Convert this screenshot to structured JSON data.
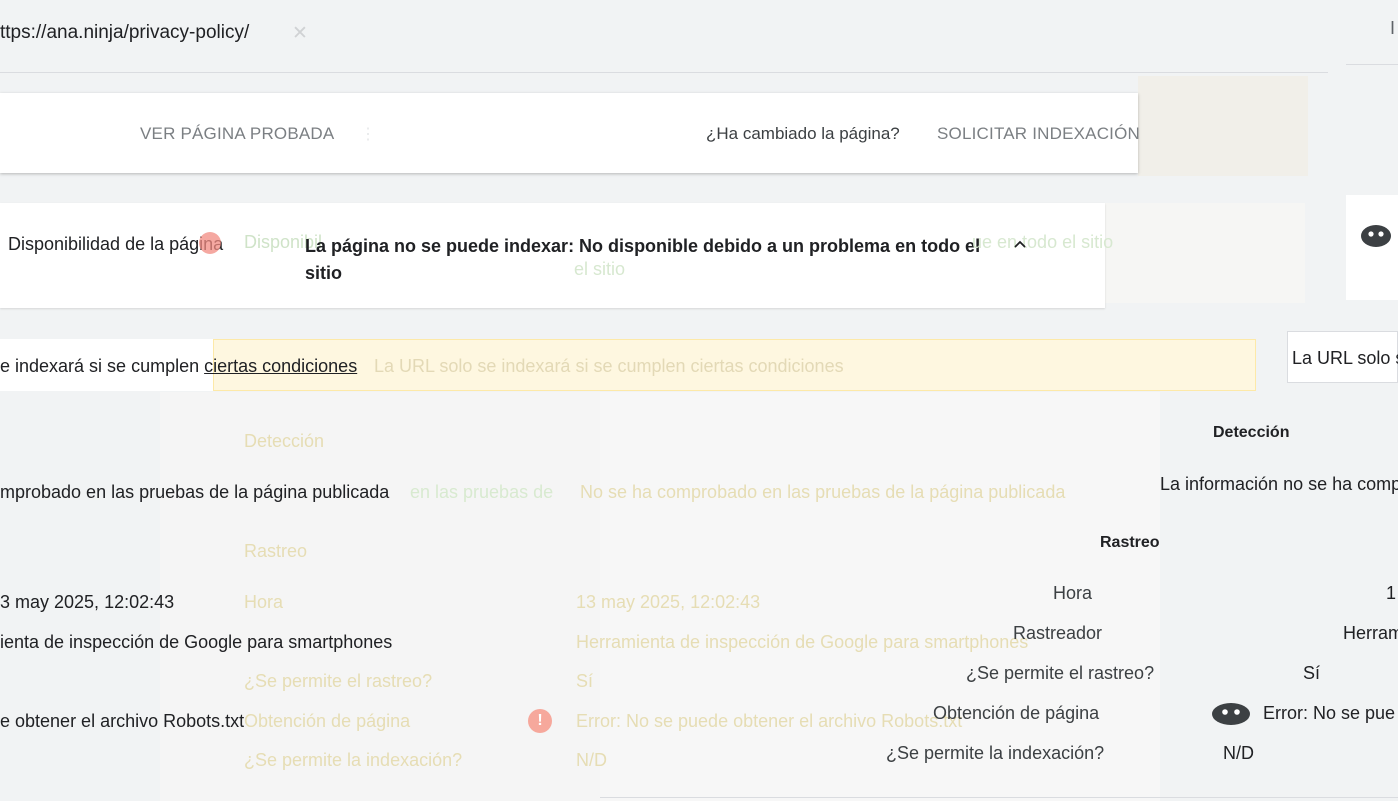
{
  "url_bar": {
    "url": "ttps://ana.ninja/privacy-policy/",
    "ghost_text": "✕",
    "right_mark": "I"
  },
  "actions": {
    "view_tested_page": "VER PÁGINA PROBADA",
    "view_tested_ghost": "⋮",
    "page_changed_question": "¿Ha cambiado la página?",
    "request_indexing": "SOLICITAR INDEXACIÓN"
  },
  "availability": {
    "label": "Disponibilidad de la página",
    "ghost_1": "Disponibil",
    "message": "La página no se puede indexar: No disponible debido a un problema en todo el sitio",
    "ghost_2": "ue en todo el sitio",
    "ghost_3": "el sitio"
  },
  "condition": {
    "text_before": "e indexará si se cumplen ",
    "link": "ciertas condiciones",
    "ghost": "La URL solo se indexará si se cumplen ciertas condiciones",
    "right_text": "La URL solo s"
  },
  "detection": {
    "title": "Detección",
    "title_ghost": "Detección",
    "left_text": "mprobado en las pruebas de la página publicada",
    "ghost_1": "en las pruebas de",
    "ghost_2": "No se ha comprobado en las pruebas de la página publicada",
    "right_text": "La información no se ha comprobado"
  },
  "crawl": {
    "title": "Rastreo",
    "title_ghost": "Rastreo",
    "time_label": "Hora",
    "time_value_left": "3 may 2025, 12:02:43",
    "time_ghost_label": "Hora",
    "time_ghost_value": "13 may 2025, 12:02:43",
    "time_value_right": "1",
    "crawler_label": "Rastreador",
    "crawler_value_left": "ienta de inspección de Google para smartphones",
    "crawler_ghost_value": "Herramienta de inspección de Google para smartphones",
    "crawler_value_right": "Herram",
    "allowed_label": "¿Se permite el rastreo?",
    "allowed_ghost_label": "¿Se permite el rastreo?",
    "allowed_ghost_value": "Sí",
    "allowed_value": "Sí",
    "fetch_label": "Obtención de página",
    "fetch_ghost_label": "Obtención de página",
    "fetch_error_symbol": "!",
    "fetch_value_left": "e obtener el archivo Robots.txt",
    "fetch_ghost_value": "Error: No se puede obtener el archivo Robots.txt",
    "fetch_value_right": "Error: No se pue",
    "indexing_label": "¿Se permite la indexación?",
    "indexing_ghost_label": "¿Se permite la indexación?",
    "indexing_ghost_value": "N/D",
    "indexing_value": "N/D"
  },
  "colors": {
    "error": "#f28b82",
    "warning_bg": "#fef7e0",
    "text": "#202124"
  },
  "icons": {
    "chevron": "chevron-up-icon",
    "face": "warning-face-icon",
    "error": "error-icon"
  }
}
